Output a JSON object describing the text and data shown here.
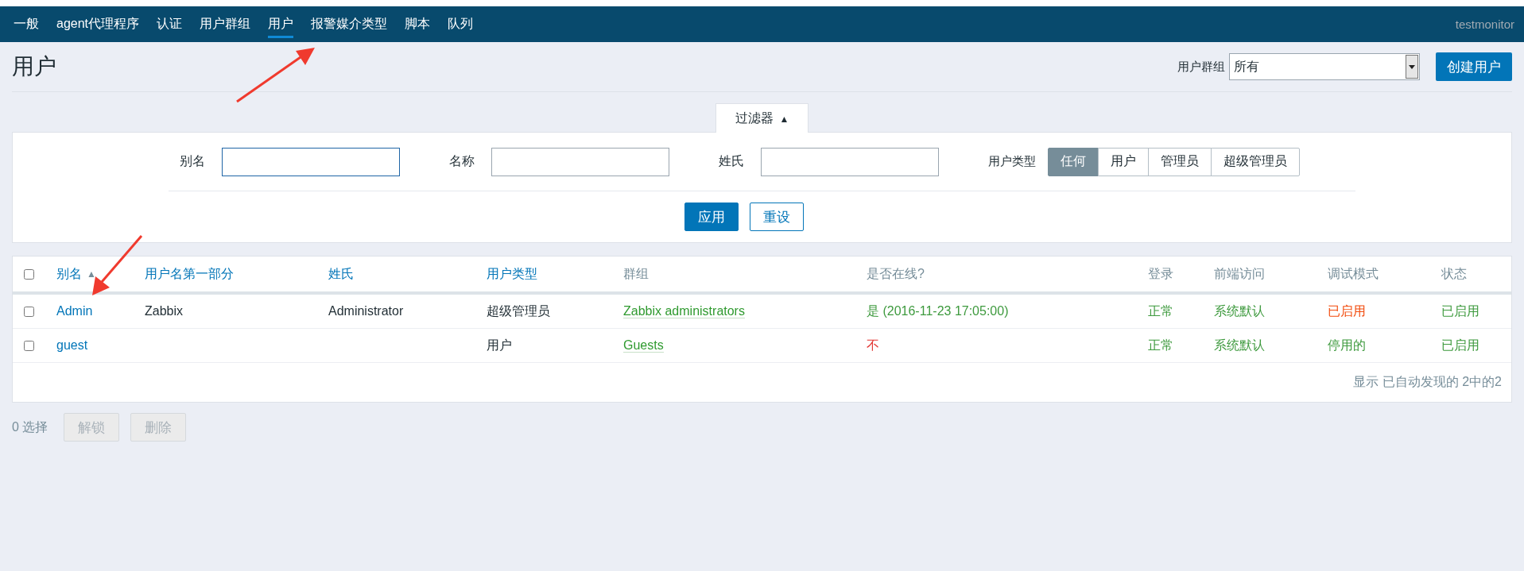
{
  "topnav": {
    "items": [
      {
        "label": "一般",
        "selected": false
      },
      {
        "label": "agent代理程序",
        "selected": false
      },
      {
        "label": "认证",
        "selected": false
      },
      {
        "label": "用户群组",
        "selected": false
      },
      {
        "label": "用户",
        "selected": true
      },
      {
        "label": "报警媒介类型",
        "selected": false
      },
      {
        "label": "脚本",
        "selected": false
      },
      {
        "label": "队列",
        "selected": false
      }
    ],
    "user": "testmonitor"
  },
  "header": {
    "title": "用户",
    "group_label": "用户群组",
    "group_value": "所有",
    "create_button": "创建用户"
  },
  "filter": {
    "tab": "过滤器",
    "tab_icon": "▲",
    "fields": [
      {
        "label": "别名",
        "focused": true
      },
      {
        "label": "名称",
        "focused": false
      },
      {
        "label": "姓氏",
        "focused": false
      }
    ],
    "type_label": "用户类型",
    "types": [
      {
        "label": "任何",
        "selected": true
      },
      {
        "label": "用户",
        "selected": false
      },
      {
        "label": "管理员",
        "selected": false
      },
      {
        "label": "超级管理员",
        "selected": false
      }
    ],
    "apply": "应用",
    "reset": "重设"
  },
  "table": {
    "select_all_checked": false,
    "columns": [
      {
        "label": "别名",
        "sortable": true,
        "sorted": true
      },
      {
        "label": "用户名第一部分",
        "sortable": true,
        "sorted": false
      },
      {
        "label": "姓氏",
        "sortable": true,
        "sorted": false
      },
      {
        "label": "用户类型",
        "sortable": true,
        "sorted": false
      },
      {
        "label": "群组",
        "sortable": false
      },
      {
        "label": "是否在线?",
        "sortable": false
      },
      {
        "label": "登录",
        "sortable": false
      },
      {
        "label": "前端访问",
        "sortable": false
      },
      {
        "label": "调试模式",
        "sortable": false
      },
      {
        "label": "状态",
        "sortable": false
      }
    ],
    "sort_icon": "▲",
    "rows": [
      {
        "checked": false,
        "alias": "Admin",
        "name": "Zabbix",
        "surname": "Administrator",
        "type": "超级管理员",
        "group": "Zabbix administrators",
        "online": {
          "text": "是 (2016-11-23 17:05:00)",
          "color": "#3e9a3e"
        },
        "login": {
          "text": "正常",
          "color": "#3e9a3e"
        },
        "frontend": {
          "text": "系统默认",
          "color": "#3e9a3e"
        },
        "debug": {
          "text": "已启用",
          "color": "#f24c0e"
        },
        "status": {
          "text": "已启用",
          "color": "#3e9a3e"
        }
      },
      {
        "checked": false,
        "alias": "guest",
        "type": "用户",
        "group": "Guests",
        "online": {
          "text": "不",
          "color": "#e33734"
        },
        "login": {
          "text": "正常",
          "color": "#3e9a3e"
        },
        "frontend": {
          "text": "系统默认",
          "color": "#3e9a3e"
        },
        "debug": {
          "text": "停用的",
          "color": "#3e9a3e"
        },
        "status": {
          "text": "已启用",
          "color": "#3e9a3e"
        }
      }
    ],
    "footer": "显示 已自动发现的 2中的2"
  },
  "actions": {
    "selected_count": "0 选择",
    "buttons": [
      {
        "label": "解锁",
        "disabled": true
      },
      {
        "label": "删除",
        "disabled": true
      }
    ]
  }
}
